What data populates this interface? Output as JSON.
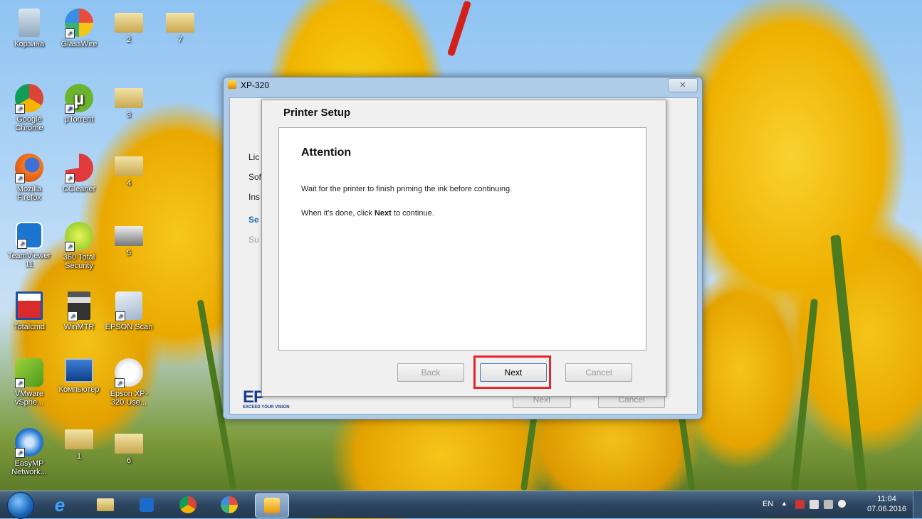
{
  "desktop": {
    "icons": [
      {
        "label": "Корзина",
        "icon": "recycle-bin-icon"
      },
      {
        "label": "GlassWire",
        "icon": "glasswire-icon"
      },
      {
        "label": "2",
        "icon": "folder-icon"
      },
      {
        "label": "7",
        "icon": "folder-icon"
      },
      {
        "label": "Google Chrome",
        "icon": "chrome-icon"
      },
      {
        "label": "µTorrent",
        "icon": "utorrent-icon"
      },
      {
        "label": "3",
        "icon": "folder-icon"
      },
      {
        "label": "Mozilla Firefox",
        "icon": "firefox-icon"
      },
      {
        "label": "CCleaner",
        "icon": "ccleaner-icon"
      },
      {
        "label": "4",
        "icon": "folder-icon"
      },
      {
        "label": "TeamViewer 11",
        "icon": "teamviewer-icon"
      },
      {
        "label": "360 Total Security",
        "icon": "security-icon"
      },
      {
        "label": "5",
        "icon": "folder-icon"
      },
      {
        "label": "Totalcmd",
        "icon": "totalcmd-icon"
      },
      {
        "label": "WinMTR",
        "icon": "winmtr-icon"
      },
      {
        "label": "EPSON Scan",
        "icon": "scanner-icon"
      },
      {
        "label": "VMware vSphe...",
        "icon": "vmware-icon"
      },
      {
        "label": "Компьютер",
        "icon": "computer-icon"
      },
      {
        "label": "Epson XP-320 Use...",
        "icon": "document-icon"
      },
      {
        "label": "EasyMP Network...",
        "icon": "easymp-icon"
      },
      {
        "label": "1",
        "icon": "folder-icon"
      },
      {
        "label": "6",
        "icon": "folder-icon"
      }
    ]
  },
  "installer": {
    "title": "XP-320",
    "close_glyph": "✕",
    "steps": [
      "Lic",
      "Sof",
      "Ins",
      "Se",
      "Su"
    ],
    "logo_text": "EP",
    "logo_tagline": "EXCEED YOUR VISION",
    "bg_next_label": "Next",
    "bg_cancel_label": "Cancel"
  },
  "dialog": {
    "title": "Printer Setup",
    "heading": "Attention",
    "line1": "Wait for the printer to finish priming the ink before continuing.",
    "line2_prefix": "When it's done, click ",
    "line2_bold": "Next",
    "line2_suffix": " to continue.",
    "back_label": "Back",
    "next_label": "Next",
    "cancel_label": "Cancel"
  },
  "taskbar": {
    "items": [
      "start-button",
      "internet-explorer-icon",
      "explorer-icon",
      "outlook-icon",
      "chrome-icon",
      "glasswire-icon",
      "installer-icon"
    ],
    "language": "EN",
    "tray_arrow": "▲",
    "time": "11:04",
    "date": "07.06.2016"
  },
  "colors": {
    "highlight": "#e8232a",
    "accent": "#1a6ab0"
  }
}
